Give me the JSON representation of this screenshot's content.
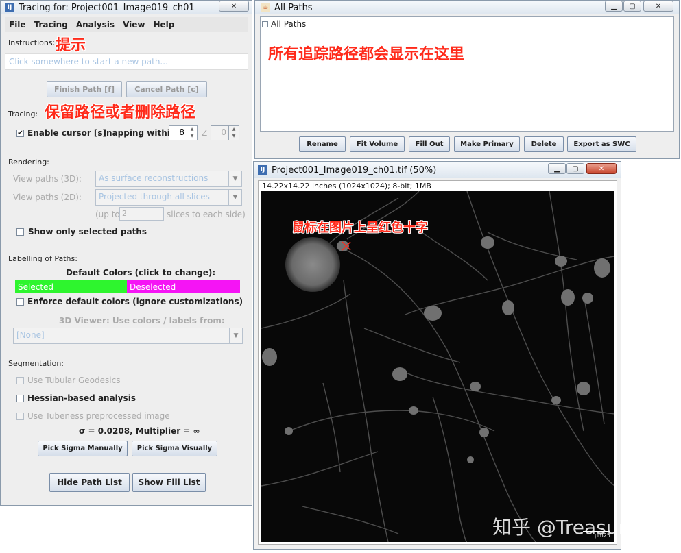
{
  "tracing": {
    "title": "Tracing for: Project001_Image019_ch01",
    "close_glyph": "✕",
    "menu": [
      "File",
      "Tracing",
      "Analysis",
      "View",
      "Help"
    ],
    "instructions_label": "Instructions:",
    "instructions_note": "提示",
    "hint": "Click somewhere to start a new path...",
    "finish_path": "Finish Path [f]",
    "cancel_path": "Cancel Path [c]",
    "tracing_label": "Tracing:",
    "tracing_note": "保留路径或者删除路径",
    "snapping_label": "Enable cursor [s]napping within: XY",
    "snapping_checked": "✔",
    "xy_value": "8",
    "z_label": "Z",
    "z_value": "0",
    "rendering_label": "Rendering:",
    "view3d_label": "View paths (3D):",
    "view3d_value": "As surface reconstructions",
    "view2d_label": "View paths (2D):",
    "view2d_value": "Projected through all slices",
    "upto_label": "(up to",
    "upto_value": "2",
    "slices_label": "slices to each side)",
    "show_selected": "Show only selected paths",
    "labelling_label": "Labelling of Paths:",
    "default_colors": "Default Colors (click to change):",
    "selected_label": "Selected",
    "deselected_label": "Deselected",
    "selected_color": "#2ef52e",
    "deselected_color": "#f514f5",
    "enforce_colors": "Enforce default colors (ignore customizations)",
    "viewer_label": "3D Viewer: Use colors / labels from:",
    "viewer_value": "[None]",
    "segmentation_label": "Segmentation:",
    "tubular": "Use Tubular Geodesics",
    "hessian": "Hessian-based analysis",
    "tubeness": "Use Tubeness preprocessed image",
    "sigma": "σ = 0.0208, Multiplier = ∞",
    "pick_manual": "Pick Sigma Manually",
    "pick_visual": "Pick Sigma Visually",
    "hide_path_list": "Hide Path List",
    "show_fill_list": "Show Fill List"
  },
  "paths": {
    "title": "All Paths",
    "tree_root": "All Paths",
    "note": "所有追踪路径都会显示在这里",
    "buttons": [
      "Rename",
      "Fit Volume",
      "Fill Out",
      "Make Primary",
      "Delete",
      "Export as SWC"
    ],
    "close_glyph": "✕"
  },
  "image": {
    "title": "Project001_Image019_ch01.tif (50%)",
    "info": "14.22x14.22 inches (1024x1024); 8-bit; 1MB",
    "note": "鼠标在图片上呈红色十字",
    "scale_label": "μm25",
    "close_glyph": "✕"
  },
  "watermark": "知乎 @Treasure琛"
}
